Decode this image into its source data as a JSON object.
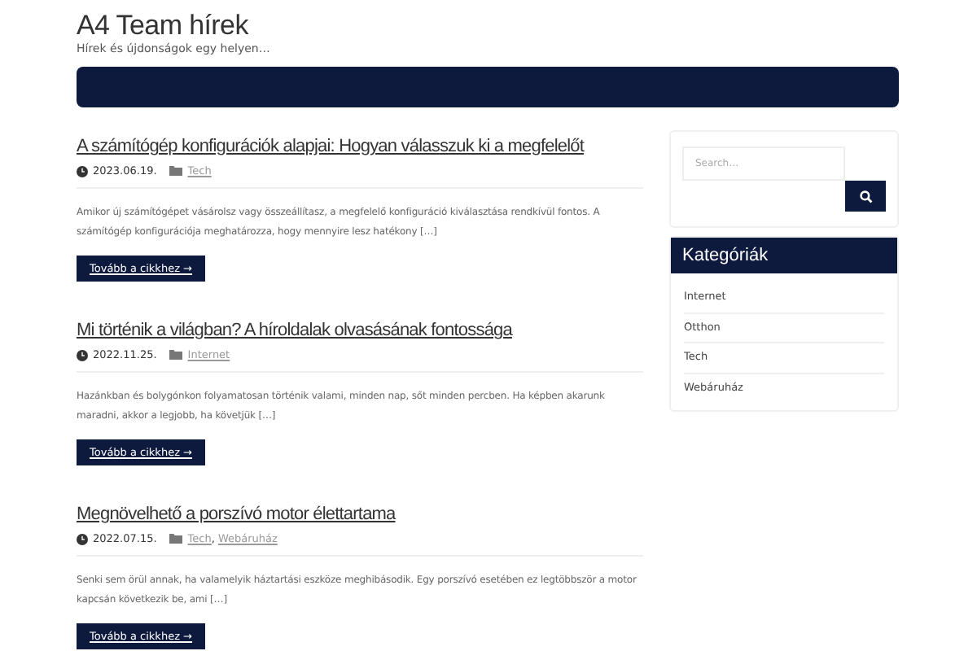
{
  "site": {
    "title": "A4 Team hírek",
    "tagline": "Hírek és újdonságok egy helyen…"
  },
  "posts": [
    {
      "title": "A számítógép konfigurációk alapjai: Hogyan válasszuk ki a megfelelőt",
      "date": "2023.06.19.",
      "categories": [
        "Tech"
      ],
      "excerpt": "Amikor új számítógépet vásárolsz vagy összeállítasz, a megfelelő konfiguráció kiválasztása rendkívül fontos. A számítógép konfigurációja meghatározza, hogy mennyire lesz hatékony […]",
      "button": "Tovább a cikkhez →"
    },
    {
      "title": "Mi történik a világban? A híroldalak olvasásának fontossága",
      "date": "2022.11.25.",
      "categories": [
        "Internet"
      ],
      "excerpt": "Hazánkban és bolygónkon folyamatosan történik valami, minden nap, sőt minden percben. Ha képben akarunk maradni, akkor a legjobb, ha követjük […]",
      "button": "Tovább a cikkhez →"
    },
    {
      "title": "Megnövelhető a porszívó motor élettartama",
      "date": "2022.07.15.",
      "categories": [
        "Tech",
        "Webáruház"
      ],
      "excerpt": "Senki sem örül annak, ha valamelyik háztartási eszköze meghibásodik. Egy porszívó esetében ez legtöbbször a motor kapcsán következik be, ami […]",
      "button": "Tovább a cikkhez →"
    }
  ],
  "category_separator": ",",
  "sidebar": {
    "search": {
      "placeholder": "Search…"
    },
    "categories": {
      "title": "Kategóriák",
      "items": [
        "Internet",
        "Otthon",
        "Tech",
        "Webáruház"
      ]
    }
  }
}
